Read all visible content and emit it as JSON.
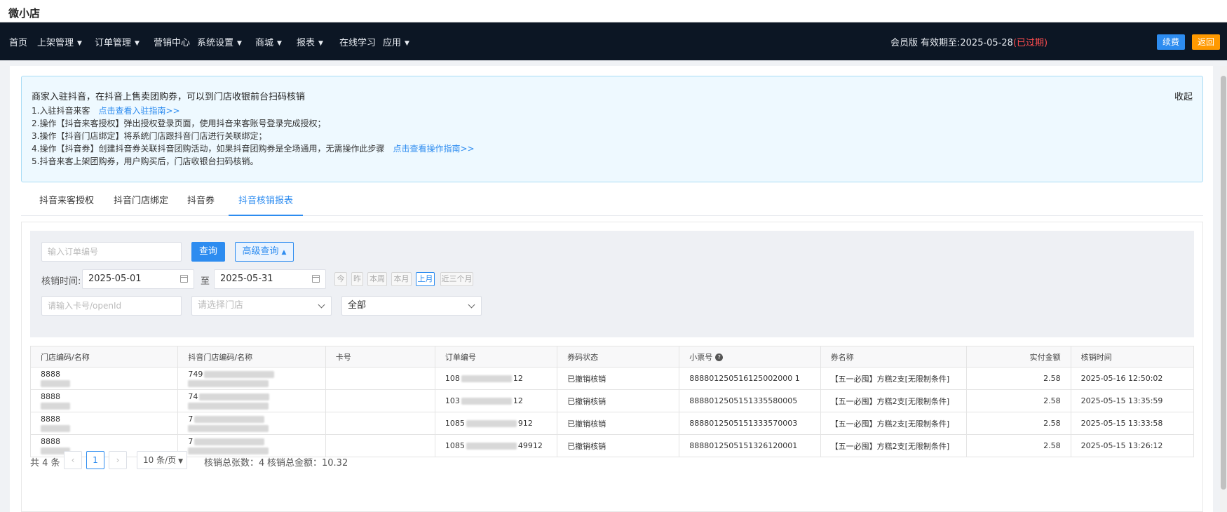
{
  "app": {
    "title": "微小店"
  },
  "nav": {
    "items": [
      {
        "label": "首页",
        "dropdown": false
      },
      {
        "label": "上架管理",
        "dropdown": true
      },
      {
        "label": "订单管理",
        "dropdown": true
      },
      {
        "label": "营销中心",
        "dropdown": false
      },
      {
        "label": "系统设置",
        "dropdown": true
      },
      {
        "label": "商城",
        "dropdown": true
      },
      {
        "label": "报表",
        "dropdown": true
      },
      {
        "label": "在线学习",
        "dropdown": false
      },
      {
        "label": "应用",
        "dropdown": true
      }
    ],
    "member": "会员版",
    "expiry_prefix": "有效期至:2025-05-28",
    "expired": "(已过期)",
    "renew": "续费",
    "back": "返回"
  },
  "notice": {
    "title": "商家入驻抖音，在抖音上售卖团购券，可以到门店收银前台扫码核销",
    "collapse": "收起",
    "lines": [
      {
        "text": "1.入驻抖音来客",
        "link": "点击查看入驻指南>>"
      },
      {
        "text": "2.操作【抖音来客授权】弹出授权登录页面，使用抖音来客账号登录完成授权；",
        "link": ""
      },
      {
        "text": "3.操作【抖音门店绑定】将系统门店跟抖音门店进行关联绑定；",
        "link": ""
      },
      {
        "text": "4.操作【抖音券】创建抖音券关联抖音团购活动，如果抖音团购券是全场通用，无需操作此步骤",
        "link": "点击查看操作指南>>"
      },
      {
        "text": "5.抖音来客上架团购券，用户购买后，门店收银台扫码核销。",
        "link": ""
      }
    ]
  },
  "tabs": [
    {
      "label": "抖音来客授权",
      "active": false
    },
    {
      "label": "抖音门店绑定",
      "active": false
    },
    {
      "label": "抖音券",
      "active": false
    },
    {
      "label": "抖音核销报表",
      "active": true
    }
  ],
  "filter": {
    "order_placeholder": "输入订单编号",
    "query": "查询",
    "advanced": "高级查询",
    "time_label": "核销时间:",
    "date_from": "2025-05-01",
    "to": "至",
    "date_to": "2025-05-31",
    "quick": [
      {
        "label": "今",
        "active": false
      },
      {
        "label": "昨",
        "active": false
      },
      {
        "label": "本周",
        "active": false
      },
      {
        "label": "本月",
        "active": false
      },
      {
        "label": "上月",
        "active": true
      },
      {
        "label": "近三个月",
        "active": false
      }
    ],
    "card_placeholder": "请输入卡号/openId",
    "store_placeholder": "请选择门店",
    "status_value": "全部"
  },
  "table": {
    "columns": [
      "门店编码/名称",
      "抖音门店编码/名称",
      "卡号",
      "订单编号",
      "券码状态",
      "小票号",
      "券名称",
      "实付金额",
      "核销时间"
    ],
    "rows": [
      {
        "store": "8888",
        "dy_store": "749",
        "card": "",
        "order_prefix": "108",
        "order_suffix": "12",
        "status": "已撤销核销",
        "ticket": "888801250516125002000 1",
        "coupon": "【五一必囤】方糕2支[无限制条件]",
        "amount": "2.58",
        "time": "2025-05-16 12:50:02"
      },
      {
        "store": "8888",
        "dy_store": "74",
        "card": "",
        "order_prefix": "103",
        "order_suffix": "12",
        "status": "已撤销核销",
        "ticket": "8888012505151335580005",
        "coupon": "【五一必囤】方糕2支[无限制条件]",
        "amount": "2.58",
        "time": "2025-05-15 13:35:59"
      },
      {
        "store": "8888",
        "dy_store": "7",
        "card": "",
        "order_prefix": "1085",
        "order_suffix": "912",
        "status": "已撤销核销",
        "ticket": "8888012505151333570003",
        "coupon": "【五一必囤】方糕2支[无限制条件]",
        "amount": "2.58",
        "time": "2025-05-15 13:33:58"
      },
      {
        "store": "8888",
        "dy_store": "7",
        "card": "",
        "order_prefix": "1085",
        "order_suffix": "49912",
        "status": "已撤销核销",
        "ticket": "8888012505151326120001",
        "coupon": "【五一必囤】方糕2支[无限制条件]",
        "amount": "2.58",
        "time": "2025-05-15 13:26:12"
      }
    ]
  },
  "pager": {
    "total": "共 4 条",
    "current": "1",
    "page_size": "10 条/页",
    "count_summary": "核销总张数：4",
    "amount_summary": "核销总金额：10.32"
  }
}
